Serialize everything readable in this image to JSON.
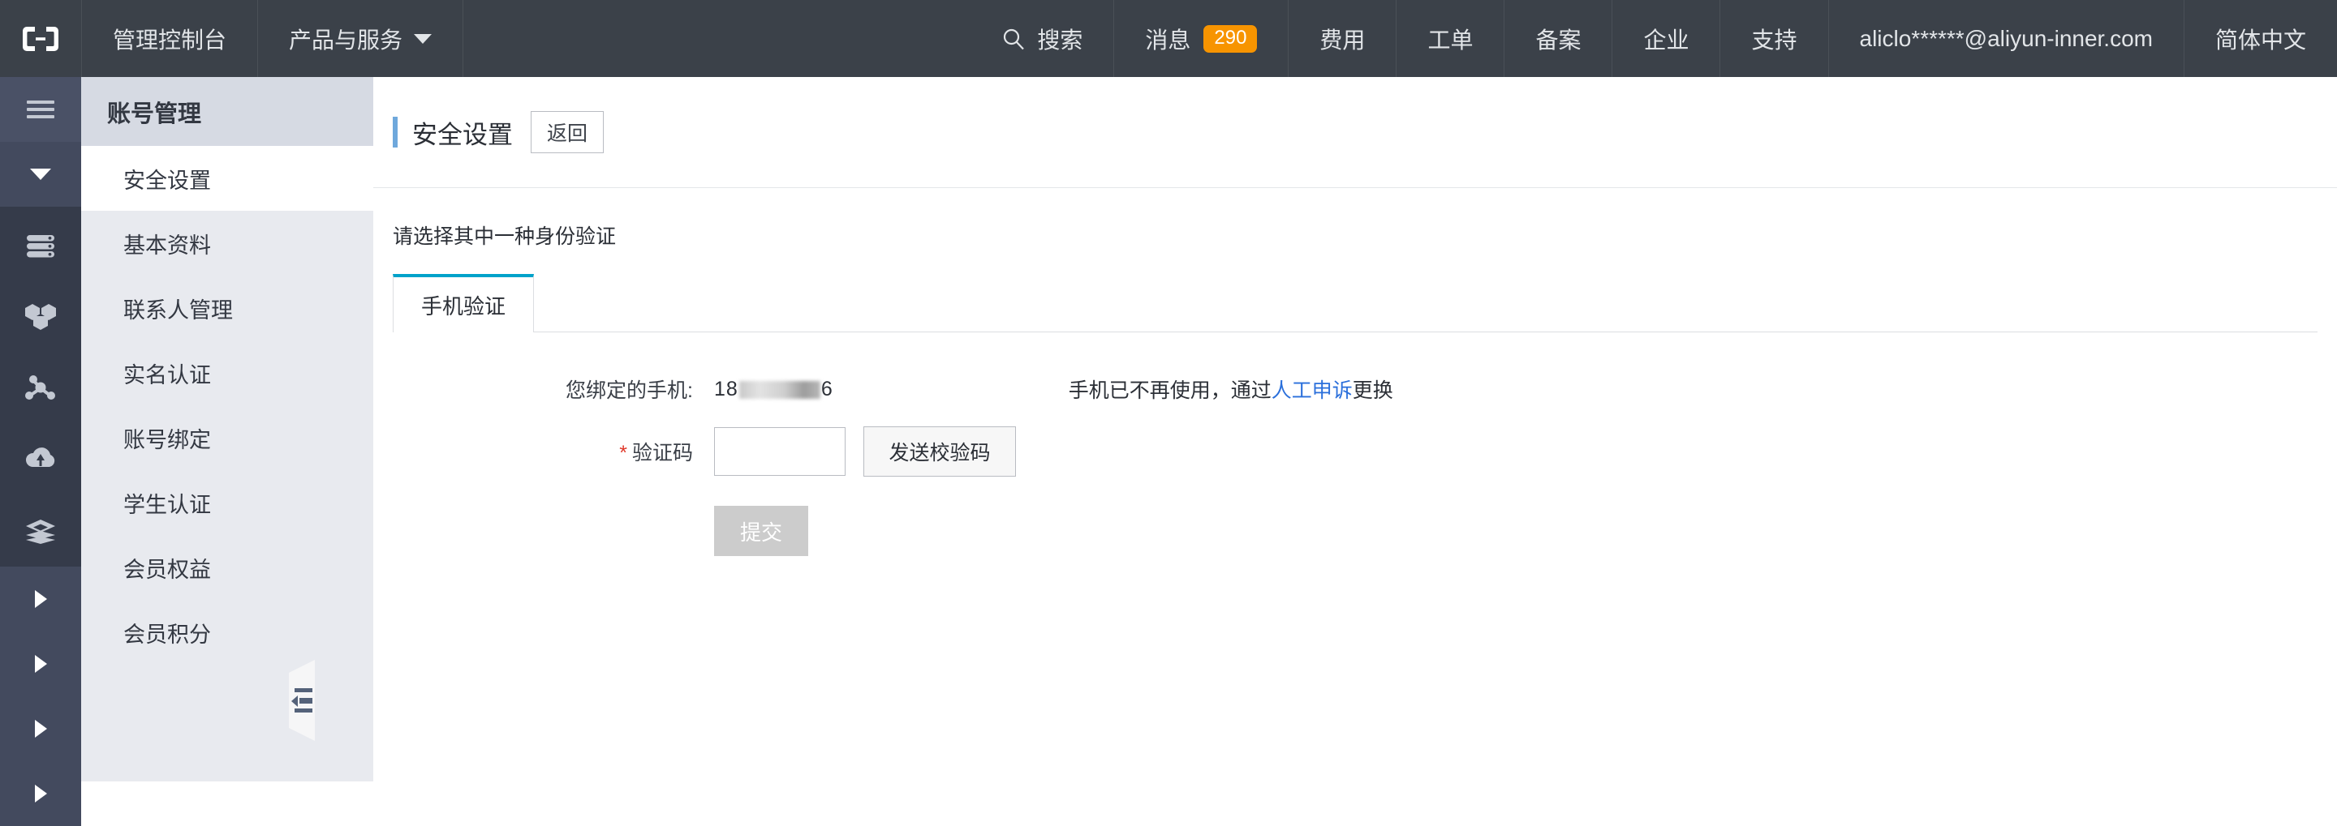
{
  "topnav": {
    "logo_icon": "aliyun-logo-icon",
    "console_label": "管理控制台",
    "products_label": "产品与服务",
    "products_caret_icon": "chevron-down-icon",
    "search_icon": "search-icon",
    "search_label": "搜索",
    "message_label": "消息",
    "message_count": "290",
    "billing_label": "费用",
    "ticket_label": "工单",
    "icp_label": "备案",
    "enterprise_label": "企业",
    "support_label": "支持",
    "account_label": "aliclo******@aliyun-inner.com",
    "language_label": "简体中文",
    "badge_color": "#f79400",
    "bar_color": "#3b4149"
  },
  "rail": {
    "hamburger_icon": "hamburger-menu-icon",
    "collapse_icon": "chevron-down-icon",
    "icons": [
      "server-stack-icon",
      "hexagon-cluster-icon",
      "network-nodes-icon",
      "cloud-upload-icon",
      "layers-icon"
    ],
    "arrows": [
      "chevron-right-icon",
      "chevron-right-icon",
      "chevron-right-icon",
      "chevron-right-icon"
    ]
  },
  "sidebar": {
    "title": "账号管理",
    "collapse_handle_icon": "collapse-panel-icon",
    "items": [
      {
        "label": "安全设置",
        "active": true
      },
      {
        "label": "基本资料",
        "active": false
      },
      {
        "label": "联系人管理",
        "active": false
      },
      {
        "label": "实名认证",
        "active": false
      },
      {
        "label": "账号绑定",
        "active": false
      },
      {
        "label": "学生认证",
        "active": false
      },
      {
        "label": "会员权益",
        "active": false
      },
      {
        "label": "会员积分",
        "active": false
      }
    ]
  },
  "main": {
    "page_title": "安全设置",
    "back_button": "返回",
    "section_label": "请选择其中一种身份验证",
    "tabs": [
      {
        "label": "手机验证",
        "active": true
      }
    ],
    "accent_color": "#00a2ca",
    "form": {
      "phone_label": "您绑定的手机:",
      "phone_prefix": "18",
      "phone_suffix": "6",
      "phone_redacted": true,
      "hint_before": "手机已不再使用，通过",
      "hint_link": "人工申诉",
      "hint_after": "更换",
      "code_required_mark": "*",
      "code_label": "验证码",
      "code_value": "",
      "code_placeholder": "",
      "send_code_button": "发送校验码",
      "submit_button": "提交",
      "submit_disabled": true
    }
  }
}
